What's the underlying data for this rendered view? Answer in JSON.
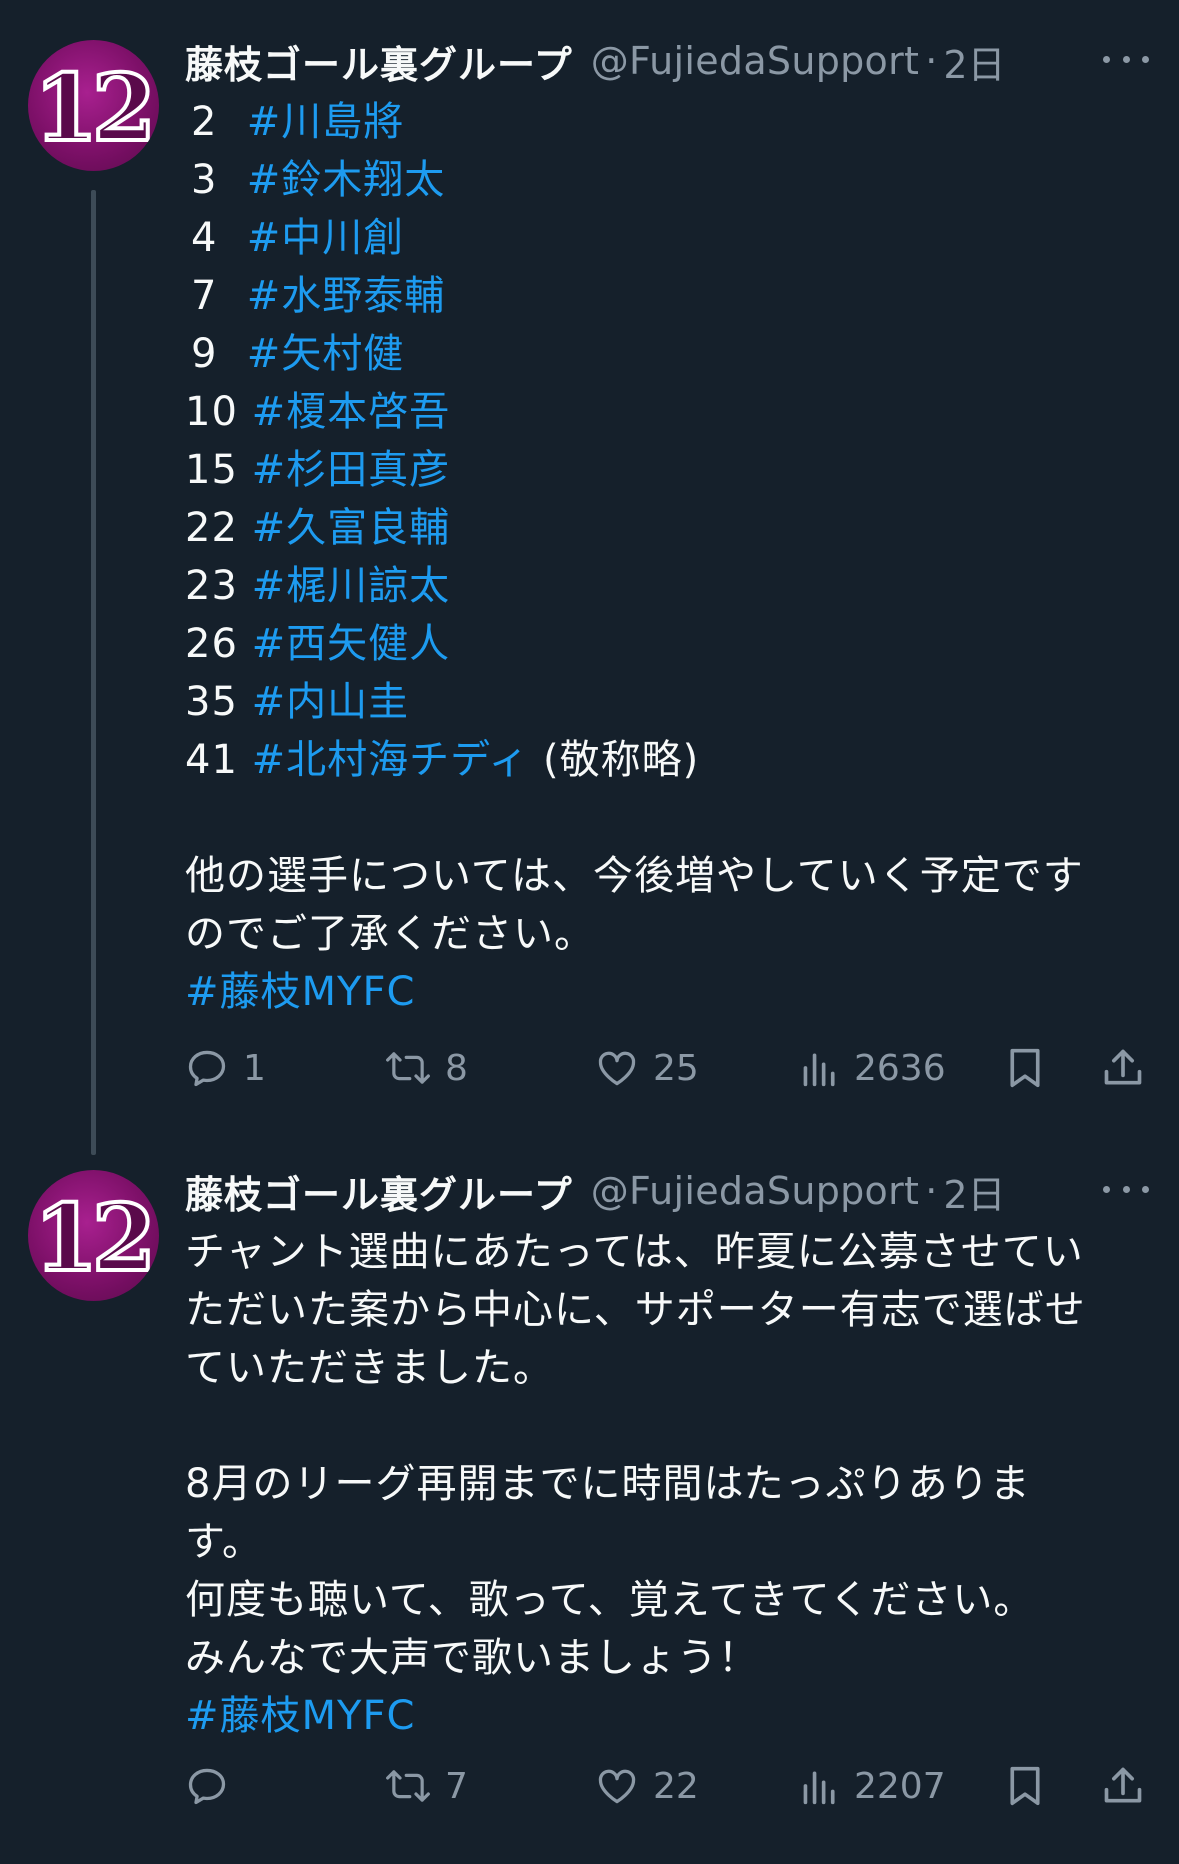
{
  "tweets": [
    {
      "author": {
        "display_name": "藤枝ゴール裏グループ",
        "handle": "@FujiedaSupport",
        "avatar_text": "12"
      },
      "separator": "·",
      "time": "2日",
      "roster": [
        {
          "number": "2",
          "tag": "#川島將"
        },
        {
          "number": "3",
          "tag": "#鈴木翔太"
        },
        {
          "number": "4",
          "tag": "#中川創"
        },
        {
          "number": "7",
          "tag": "#水野泰輔"
        },
        {
          "number": "9",
          "tag": "#矢村健"
        },
        {
          "number": "10",
          "tag": "#榎本啓吾"
        },
        {
          "number": "15",
          "tag": "#杉田真彦"
        },
        {
          "number": "22",
          "tag": "#久富良輔"
        },
        {
          "number": "23",
          "tag": "#梶川諒太"
        },
        {
          "number": "26",
          "tag": "#西矢健人"
        },
        {
          "number": "35",
          "tag": "#内山圭"
        },
        {
          "number": "41",
          "tag": "#北村海チディ",
          "suffix": " (敬称略)"
        }
      ],
      "paragraph_lines": [
        "他の選手については、今後増やしていく予定です",
        "のでご了承ください。"
      ],
      "hashtag": "#藤枝MYFC",
      "stats": {
        "replies": "1",
        "retweets": "8",
        "likes": "25",
        "views": "2636"
      }
    },
    {
      "author": {
        "display_name": "藤枝ゴール裏グループ",
        "handle": "@FujiedaSupport",
        "avatar_text": "12"
      },
      "separator": "·",
      "time": "2日",
      "para1_lines": [
        "チャント選曲にあたっては、昨夏に公募させてい",
        "ただいた案から中心に、サポーター有志で選ばせ",
        "ていただきました。"
      ],
      "para2_lines": [
        "8月のリーグ再開までに時間はたっぷりありま",
        "す。",
        "何度も聴いて、歌って、覚えてきてください。",
        "みんなで大声で歌いましょう！"
      ],
      "hashtag": "#藤枝MYFC",
      "stats": {
        "replies": "",
        "retweets": "7",
        "likes": "22",
        "views": "2207"
      }
    }
  ],
  "icons": {
    "more": "more-horizontal-icon",
    "reply": "reply-icon",
    "retweet": "retweet-icon",
    "like": "heart-icon",
    "views": "views-icon",
    "bookmark": "bookmark-icon",
    "share": "share-icon"
  },
  "colors": {
    "background": "#15202b",
    "text": "#f7f9f9",
    "secondary": "#8b98a5",
    "link": "#1d9bf0",
    "thread_line": "#3d4b57",
    "avatar": "#7d1068"
  }
}
